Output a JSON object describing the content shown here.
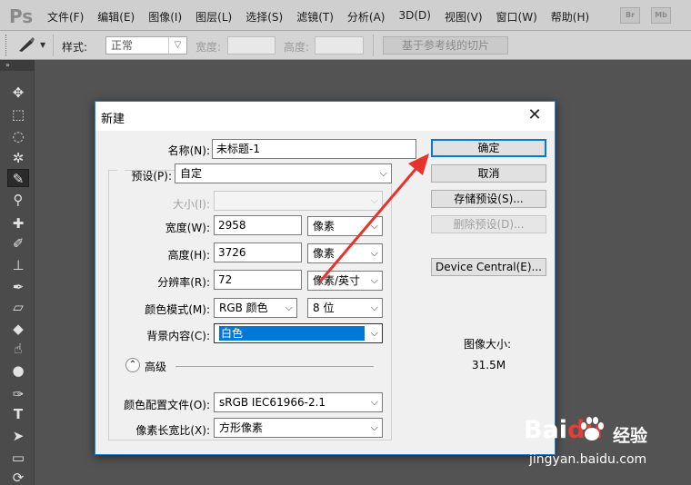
{
  "app": {
    "logo": "Ps"
  },
  "menubar": {
    "items": [
      "文件(F)",
      "编辑(E)",
      "图像(I)",
      "图层(L)",
      "选择(S)",
      "滤镜(T)",
      "分析(A)",
      "3D(D)",
      "视图(V)",
      "窗口(W)",
      "帮助(H)"
    ],
    "badges": [
      "Br",
      "Mb"
    ]
  },
  "options": {
    "style_label": "样式:",
    "style_value": "正常",
    "width_label": "宽度:",
    "height_label": "高度:",
    "slice_button": "基于参考线的切片"
  },
  "toolbox": {
    "toggle": "»"
  },
  "dialog": {
    "title": "新建",
    "close": "✕",
    "name_label": "名称(N):",
    "name_value": "未标题-1",
    "preset_label": "预设(P):",
    "preset_value": "自定",
    "size_label": "大小(I):",
    "width_label": "宽度(W):",
    "width_value": "2958",
    "width_unit": "像素",
    "height_label": "高度(H):",
    "height_value": "3726",
    "height_unit": "像素",
    "resolution_label": "分辨率(R):",
    "resolution_value": "72",
    "resolution_unit": "像素/英寸",
    "color_mode_label": "颜色模式(M):",
    "color_mode_value": "RGB 颜色",
    "bit_depth_value": "8 位",
    "background_label": "背景内容(C):",
    "background_value": "白色",
    "advanced_label": "高级",
    "color_profile_label": "颜色配置文件(O):",
    "color_profile_value": "sRGB IEC61966-2.1",
    "pixel_aspect_label": "像素长宽比(X):",
    "pixel_aspect_value": "方形像素",
    "buttons": {
      "ok": "确定",
      "cancel": "取消",
      "save_preset": "存储预设(S)...",
      "delete_preset": "删除预设(D)...",
      "device_central": "Device Central(E)..."
    },
    "image_size_label": "图像大小:",
    "image_size_value": "31.5M"
  },
  "watermark": {
    "brand_a": "Bai",
    "brand_b": "du",
    "brand_cn": "经验",
    "url": "jingyan.baidu.com"
  },
  "colors": {
    "accent": "#0078d7",
    "arrow": "#e8322c"
  }
}
